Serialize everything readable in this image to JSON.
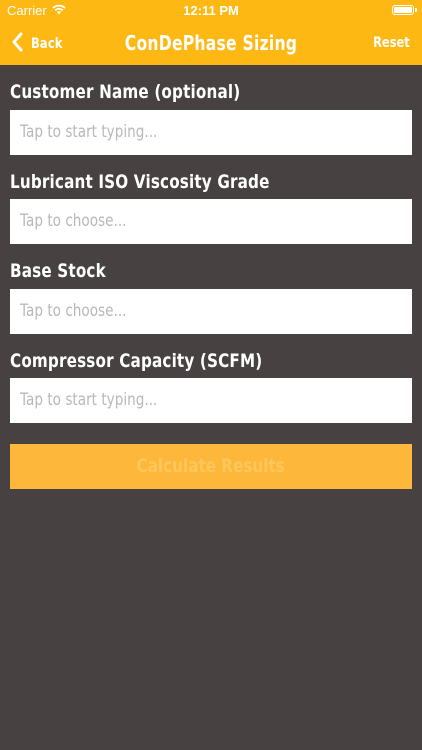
{
  "status_bar": {
    "carrier": "Carrier",
    "time": "12:11 PM",
    "wifi_icon": "wifi-icon",
    "battery_icon": "battery-icon"
  },
  "nav": {
    "back_label": "Back",
    "title": "ConDePhase Sizing",
    "reset_label": "Reset",
    "back_icon": "chevron-left-icon"
  },
  "form": {
    "fields": [
      {
        "label": "Customer Name (optional)",
        "placeholder": "Tap to start typing..."
      },
      {
        "label": "Lubricant ISO Viscosity Grade",
        "placeholder": "Tap to choose..."
      },
      {
        "label": "Base Stock",
        "placeholder": "Tap to choose..."
      },
      {
        "label": "Compressor Capacity (SCFM)",
        "placeholder": "Tap to start typing..."
      }
    ],
    "submit_label": "Calculate Results"
  },
  "colors": {
    "accent": "#fdb813",
    "background": "#474241",
    "button": "#fdb83b",
    "button_text": "#ffc75a"
  }
}
